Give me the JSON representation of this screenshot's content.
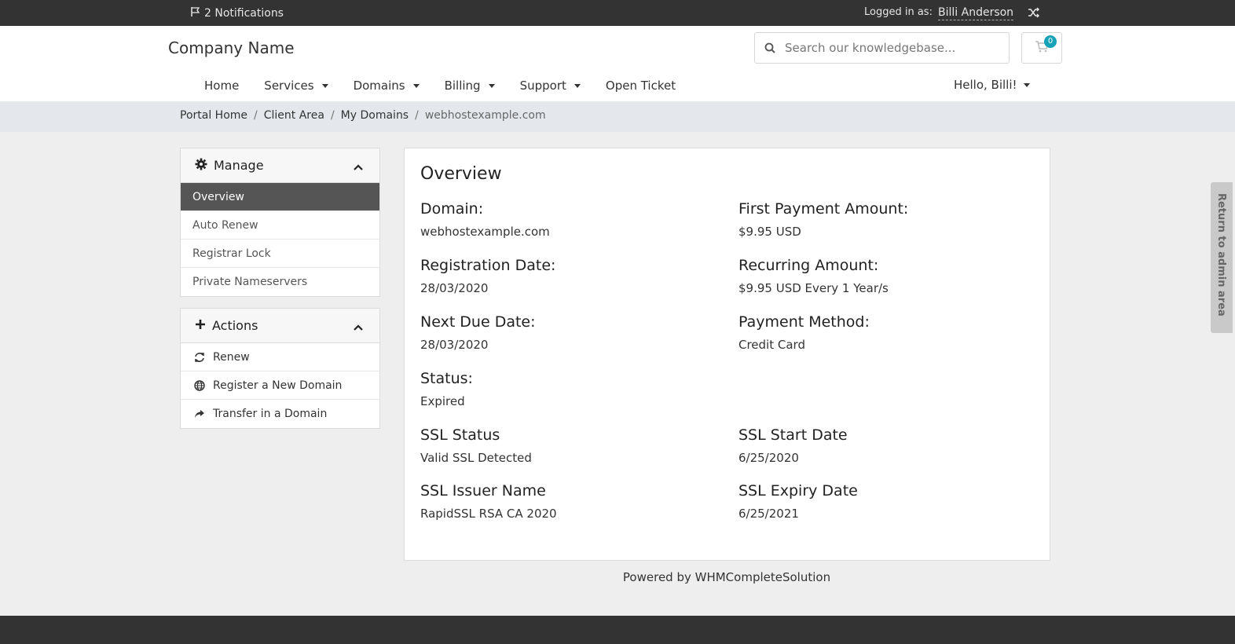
{
  "topbar": {
    "notifications": "2 Notifications",
    "logged_in_label": "Logged in as:",
    "user_name": "Billi Anderson"
  },
  "header": {
    "company": "Company Name",
    "search_placeholder": "Search our knowledgebase...",
    "cart_count": "0"
  },
  "nav": {
    "home": "Home",
    "services": "Services",
    "domains": "Domains",
    "billing": "Billing",
    "support": "Support",
    "open_ticket": "Open Ticket",
    "hello": "Hello, Billi!"
  },
  "breadcrumb": {
    "items": [
      "Portal Home",
      "Client Area",
      "My Domains"
    ],
    "current": "webhostexample.com"
  },
  "sidebar": {
    "manage": {
      "title": "Manage",
      "items": [
        "Overview",
        "Auto Renew",
        "Registrar Lock",
        "Private Nameservers"
      ]
    },
    "actions": {
      "title": "Actions",
      "items": [
        "Renew",
        "Register a New Domain",
        "Transfer in a Domain"
      ]
    }
  },
  "overview": {
    "title": "Overview",
    "domain_label": "Domain:",
    "domain_value": "webhostexample.com",
    "first_payment_label": "First Payment Amount:",
    "first_payment_value": "$9.95 USD",
    "registration_label": "Registration Date:",
    "registration_value": "28/03/2020",
    "recurring_label": "Recurring Amount:",
    "recurring_value": "$9.95 USD Every 1 Year/s",
    "next_due_label": "Next Due Date:",
    "next_due_value": "28/03/2020",
    "payment_method_label": "Payment Method:",
    "payment_method_value": "Credit Card",
    "status_label": "Status:",
    "status_value": "Expired",
    "ssl_status_label": "SSL Status",
    "ssl_status_value": "Valid SSL Detected",
    "ssl_start_label": "SSL Start Date",
    "ssl_start_value": "6/25/2020",
    "ssl_issuer_label": "SSL Issuer Name",
    "ssl_issuer_value": "RapidSSL RSA CA 2020",
    "ssl_expiry_label": "SSL Expiry Date",
    "ssl_expiry_value": "6/25/2021"
  },
  "footer": {
    "powered": "Powered by WHMCompleteSolution"
  },
  "admin_tab": {
    "label": "Return to admin area"
  },
  "colors": {
    "topbar": "#333333",
    "active_item": "#555555",
    "badge": "#17a2b8",
    "breadcrumb_bg": "#e4e8ec"
  }
}
